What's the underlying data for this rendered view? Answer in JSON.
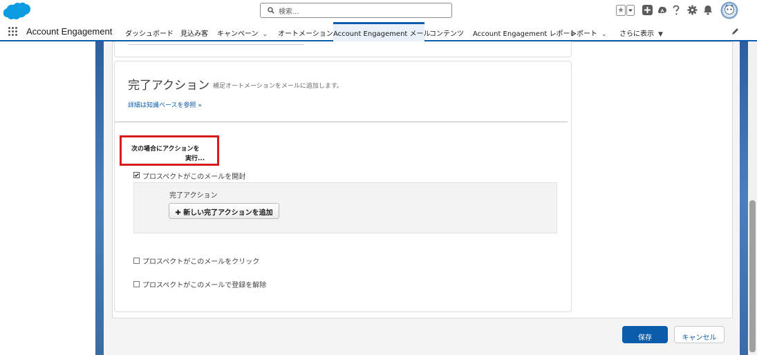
{
  "header": {
    "search_placeholder": "検索...",
    "icons": [
      "salesforce-cloud-icon",
      "search-icon",
      "favorites-star-icon",
      "favorites-dropdown-icon",
      "global-actions-plus-icon",
      "trailhead-icon",
      "help-icon",
      "setup-gear-icon",
      "notifications-bell-icon",
      "user-avatar"
    ]
  },
  "nav": {
    "app_name": "Account Engagement",
    "tabs": [
      {
        "label": "ダッシュボード"
      },
      {
        "label": "見込み客"
      },
      {
        "label": "キャンペーン"
      },
      {
        "label": "オートメーション"
      },
      {
        "label": "Account Engagement メール"
      },
      {
        "label": "コンテンツ"
      },
      {
        "label": "Account Engagement レポート"
      },
      {
        "label": "レポート"
      },
      {
        "label": "さらに表示"
      }
    ],
    "active_tab": "Account Engagement メール"
  },
  "section": {
    "title": "完了アクション",
    "subtitle": "補足オートメーションをメールに追加します。",
    "help_link": "詳細は知識ベースを参照 »",
    "when_label_line1": "次の場合にアクションを",
    "when_label_line2": "実行..."
  },
  "conditions": [
    {
      "label": "プロスペクトがこのメールを開封",
      "checked": true
    },
    {
      "label": "プロスペクトがこのメールをクリック",
      "checked": false
    },
    {
      "label": "プロスペクトがこのメールで登録を解除",
      "checked": false
    }
  ],
  "action_panel": {
    "label": "完了アクション",
    "add_button": "新しい完了アクションを追加"
  },
  "footer": {
    "save": "保存",
    "cancel": "キャンセル"
  },
  "colors": {
    "brand_blue": "#0b5cab",
    "highlight_red": "#d41c1c",
    "panel_bg": "#f3f3f3"
  }
}
